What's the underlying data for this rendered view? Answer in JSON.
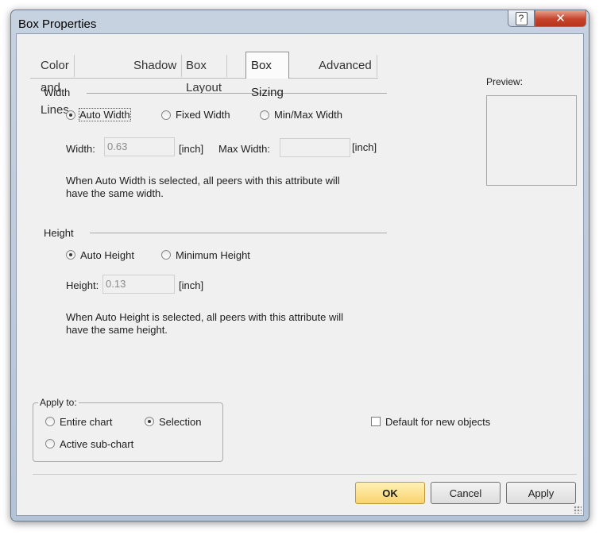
{
  "window": {
    "title": "Box Properties",
    "help_glyph": "?",
    "close_glyph": "✕"
  },
  "tabs": [
    "Color and Lines",
    "Shadow",
    "Box Layout",
    "Box Sizing",
    "Advanced"
  ],
  "active_tab": "Box Sizing",
  "width_group": {
    "title": "Width",
    "options": [
      "Auto Width",
      "Fixed Width",
      "Min/Max Width"
    ],
    "selected": "Auto Width",
    "width_label": "Width:",
    "width_value": "0.63",
    "unit": "[inch]",
    "max_width_label": "Max Width:",
    "max_width_value": "",
    "max_unit": "[inch]",
    "note_line1": "When Auto Width is selected, all peers with this attribute will",
    "note_line2": "have the same width."
  },
  "height_group": {
    "title": "Height",
    "options": [
      "Auto Height",
      "Minimum Height"
    ],
    "selected": "Auto Height",
    "height_label": "Height:",
    "height_value": "0.13",
    "unit": "[inch]",
    "note_line1": "When Auto Height is selected, all peers with this attribute will",
    "note_line2": "have the same height."
  },
  "preview": {
    "label": "Preview:"
  },
  "apply_to": {
    "title": "Apply to:",
    "options": [
      "Entire chart",
      "Selection",
      "Active sub-chart"
    ],
    "selected": "Selection"
  },
  "default_new_objects": {
    "label": "Default for new objects",
    "checked": false
  },
  "buttons": {
    "ok": "OK",
    "cancel": "Cancel",
    "apply": "Apply"
  }
}
